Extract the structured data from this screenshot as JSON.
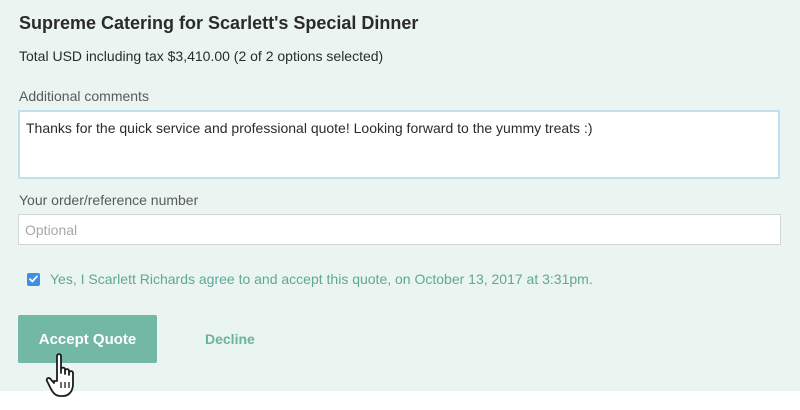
{
  "quote": {
    "title": "Supreme Catering for Scarlett's Special Dinner",
    "total": "Total USD including tax $3,410.00 (2 of 2 options selected)"
  },
  "comments": {
    "label": "Additional comments",
    "value": "Thanks for the quick service and professional quote! Looking forward to the yummy treats :)"
  },
  "reference": {
    "label": "Your order/reference number",
    "placeholder": "Optional",
    "value": ""
  },
  "agreement": {
    "checked": true,
    "text": "Yes, I Scarlett Richards agree to and accept this quote, on October 13, 2017 at 3:31pm."
  },
  "actions": {
    "accept_label": "Accept Quote",
    "decline_label": "Decline"
  },
  "icons": {
    "checkbox": "checkmark-icon",
    "cursor": "hand-pointer-icon"
  },
  "colors": {
    "background": "#eaf4f1",
    "accent": "#73b8a4",
    "agree_text": "#5fa896",
    "checkbox": "#3f8ee6",
    "focus_border": "#bfe0ef"
  }
}
